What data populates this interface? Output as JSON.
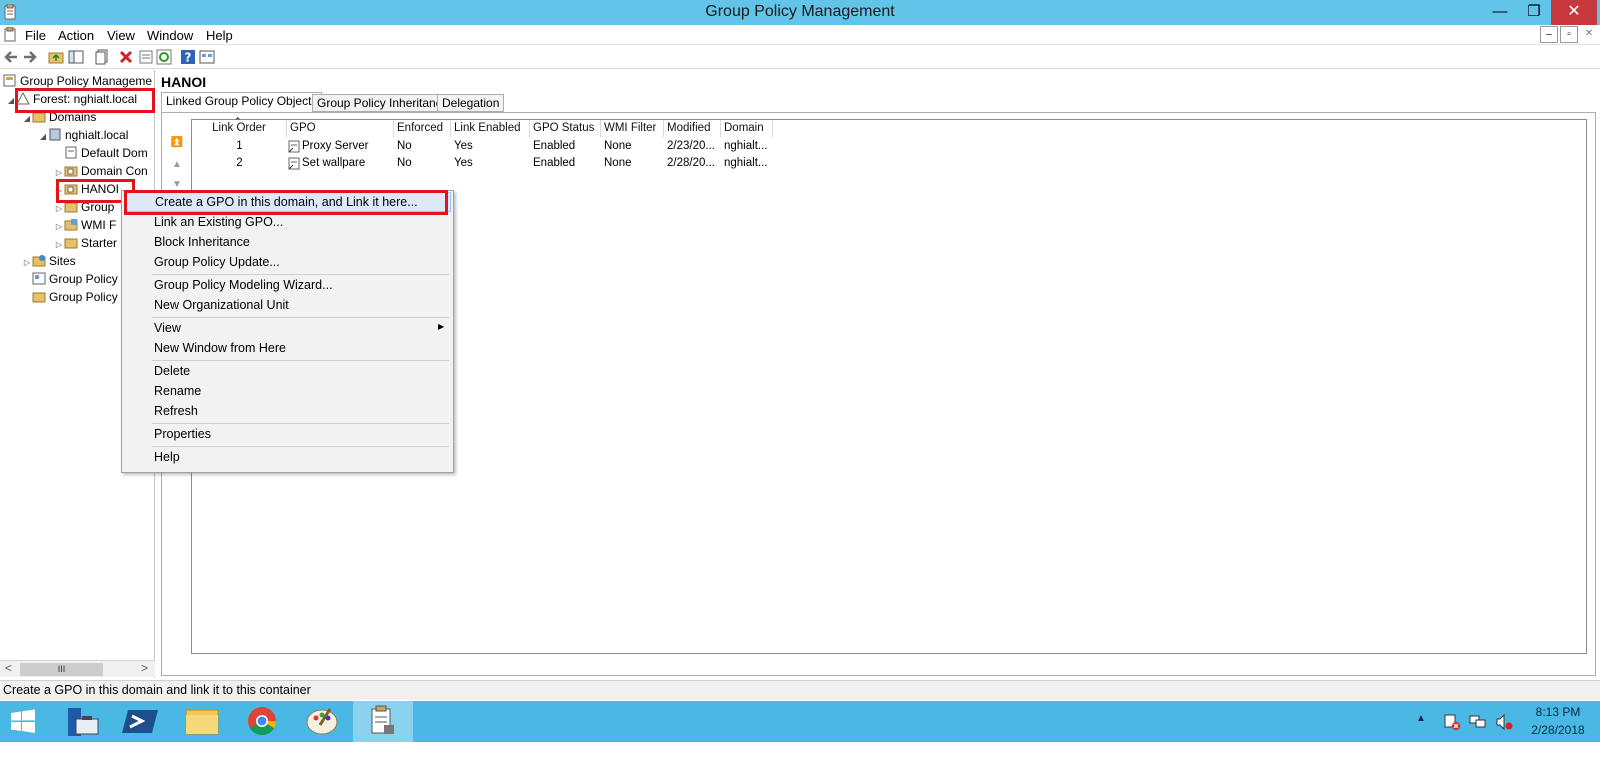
{
  "window": {
    "title": "Group Policy Management",
    "minimize_glyph": "—",
    "restore_glyph": "❐",
    "close_glyph": "✕"
  },
  "menu": {
    "file": "File",
    "action": "Action",
    "view": "View",
    "window": "Window",
    "help": "Help",
    "mdi_min": "–",
    "mdi_restore": "▫",
    "mdi_close": "✕"
  },
  "toolbar": {
    "icons": [
      "back-arrow-icon",
      "forward-arrow-icon",
      "up-folder-icon",
      "show-hide-tree-icon",
      "copy-icon",
      "delete-icon",
      "properties-icon",
      "refresh-icon",
      "help-icon",
      "console-icon"
    ]
  },
  "tree": {
    "root": "Group Policy Manageme",
    "forest": "Forest: nghialt.local",
    "domains": "Domains",
    "domain": "nghialt.local",
    "default_policy": "Default Dom",
    "domain_controllers": "Domain Con",
    "hanoi": "HANOI",
    "group_policy_objects": "Group",
    "wmi_filters": "WMI F",
    "starter_gpos": "Starter",
    "sites": "Sites",
    "modeling": "Group Policy",
    "results": "Group Policy",
    "scroll_thumb": "III",
    "scroll_left": "<",
    "scroll_right": ">"
  },
  "details": {
    "heading": "HANOI",
    "tabs": [
      "Linked Group Policy Objects",
      "Group Policy Inheritance",
      "Delegation"
    ],
    "columns": [
      "Link Order",
      "GPO",
      "Enforced",
      "Link Enabled",
      "GPO Status",
      "WMI Filter",
      "Modified",
      "Domain"
    ],
    "rows": [
      {
        "link_order": "1",
        "gpo": "Proxy Server",
        "enforced": "No",
        "link_enabled": "Yes",
        "gpo_status": "Enabled",
        "wmi_filter": "None",
        "modified": "2/23/20...",
        "domain": "nghialt..."
      },
      {
        "link_order": "2",
        "gpo": "Set wallpare",
        "enforced": "No",
        "link_enabled": "Yes",
        "gpo_status": "Enabled",
        "wmi_filter": "None",
        "modified": "2/28/20...",
        "domain": "nghialt..."
      }
    ]
  },
  "context_menu": {
    "items": [
      "Create a GPO in this domain, and Link it here...",
      "Link an Existing GPO...",
      "Block Inheritance",
      "Group Policy Update...",
      "Group Policy Modeling Wizard...",
      "New Organizational Unit",
      "View",
      "New Window from Here",
      "Delete",
      "Rename",
      "Refresh",
      "Properties",
      "Help"
    ]
  },
  "status": {
    "text": "Create a GPO in this domain and link it to this container"
  },
  "taskbar": {
    "time": "8:13 PM",
    "date": "2/28/2018",
    "apps": [
      "start-icon",
      "server-manager-icon",
      "powershell-icon",
      "file-explorer-icon",
      "chrome-icon",
      "paint-icon",
      "group-policy-icon"
    ]
  },
  "colors": {
    "titlebar": "#62c4e8",
    "taskbar": "#4ab8e4",
    "highlight_box": "#e1141c",
    "menu_hover": "#dbe9f8"
  }
}
